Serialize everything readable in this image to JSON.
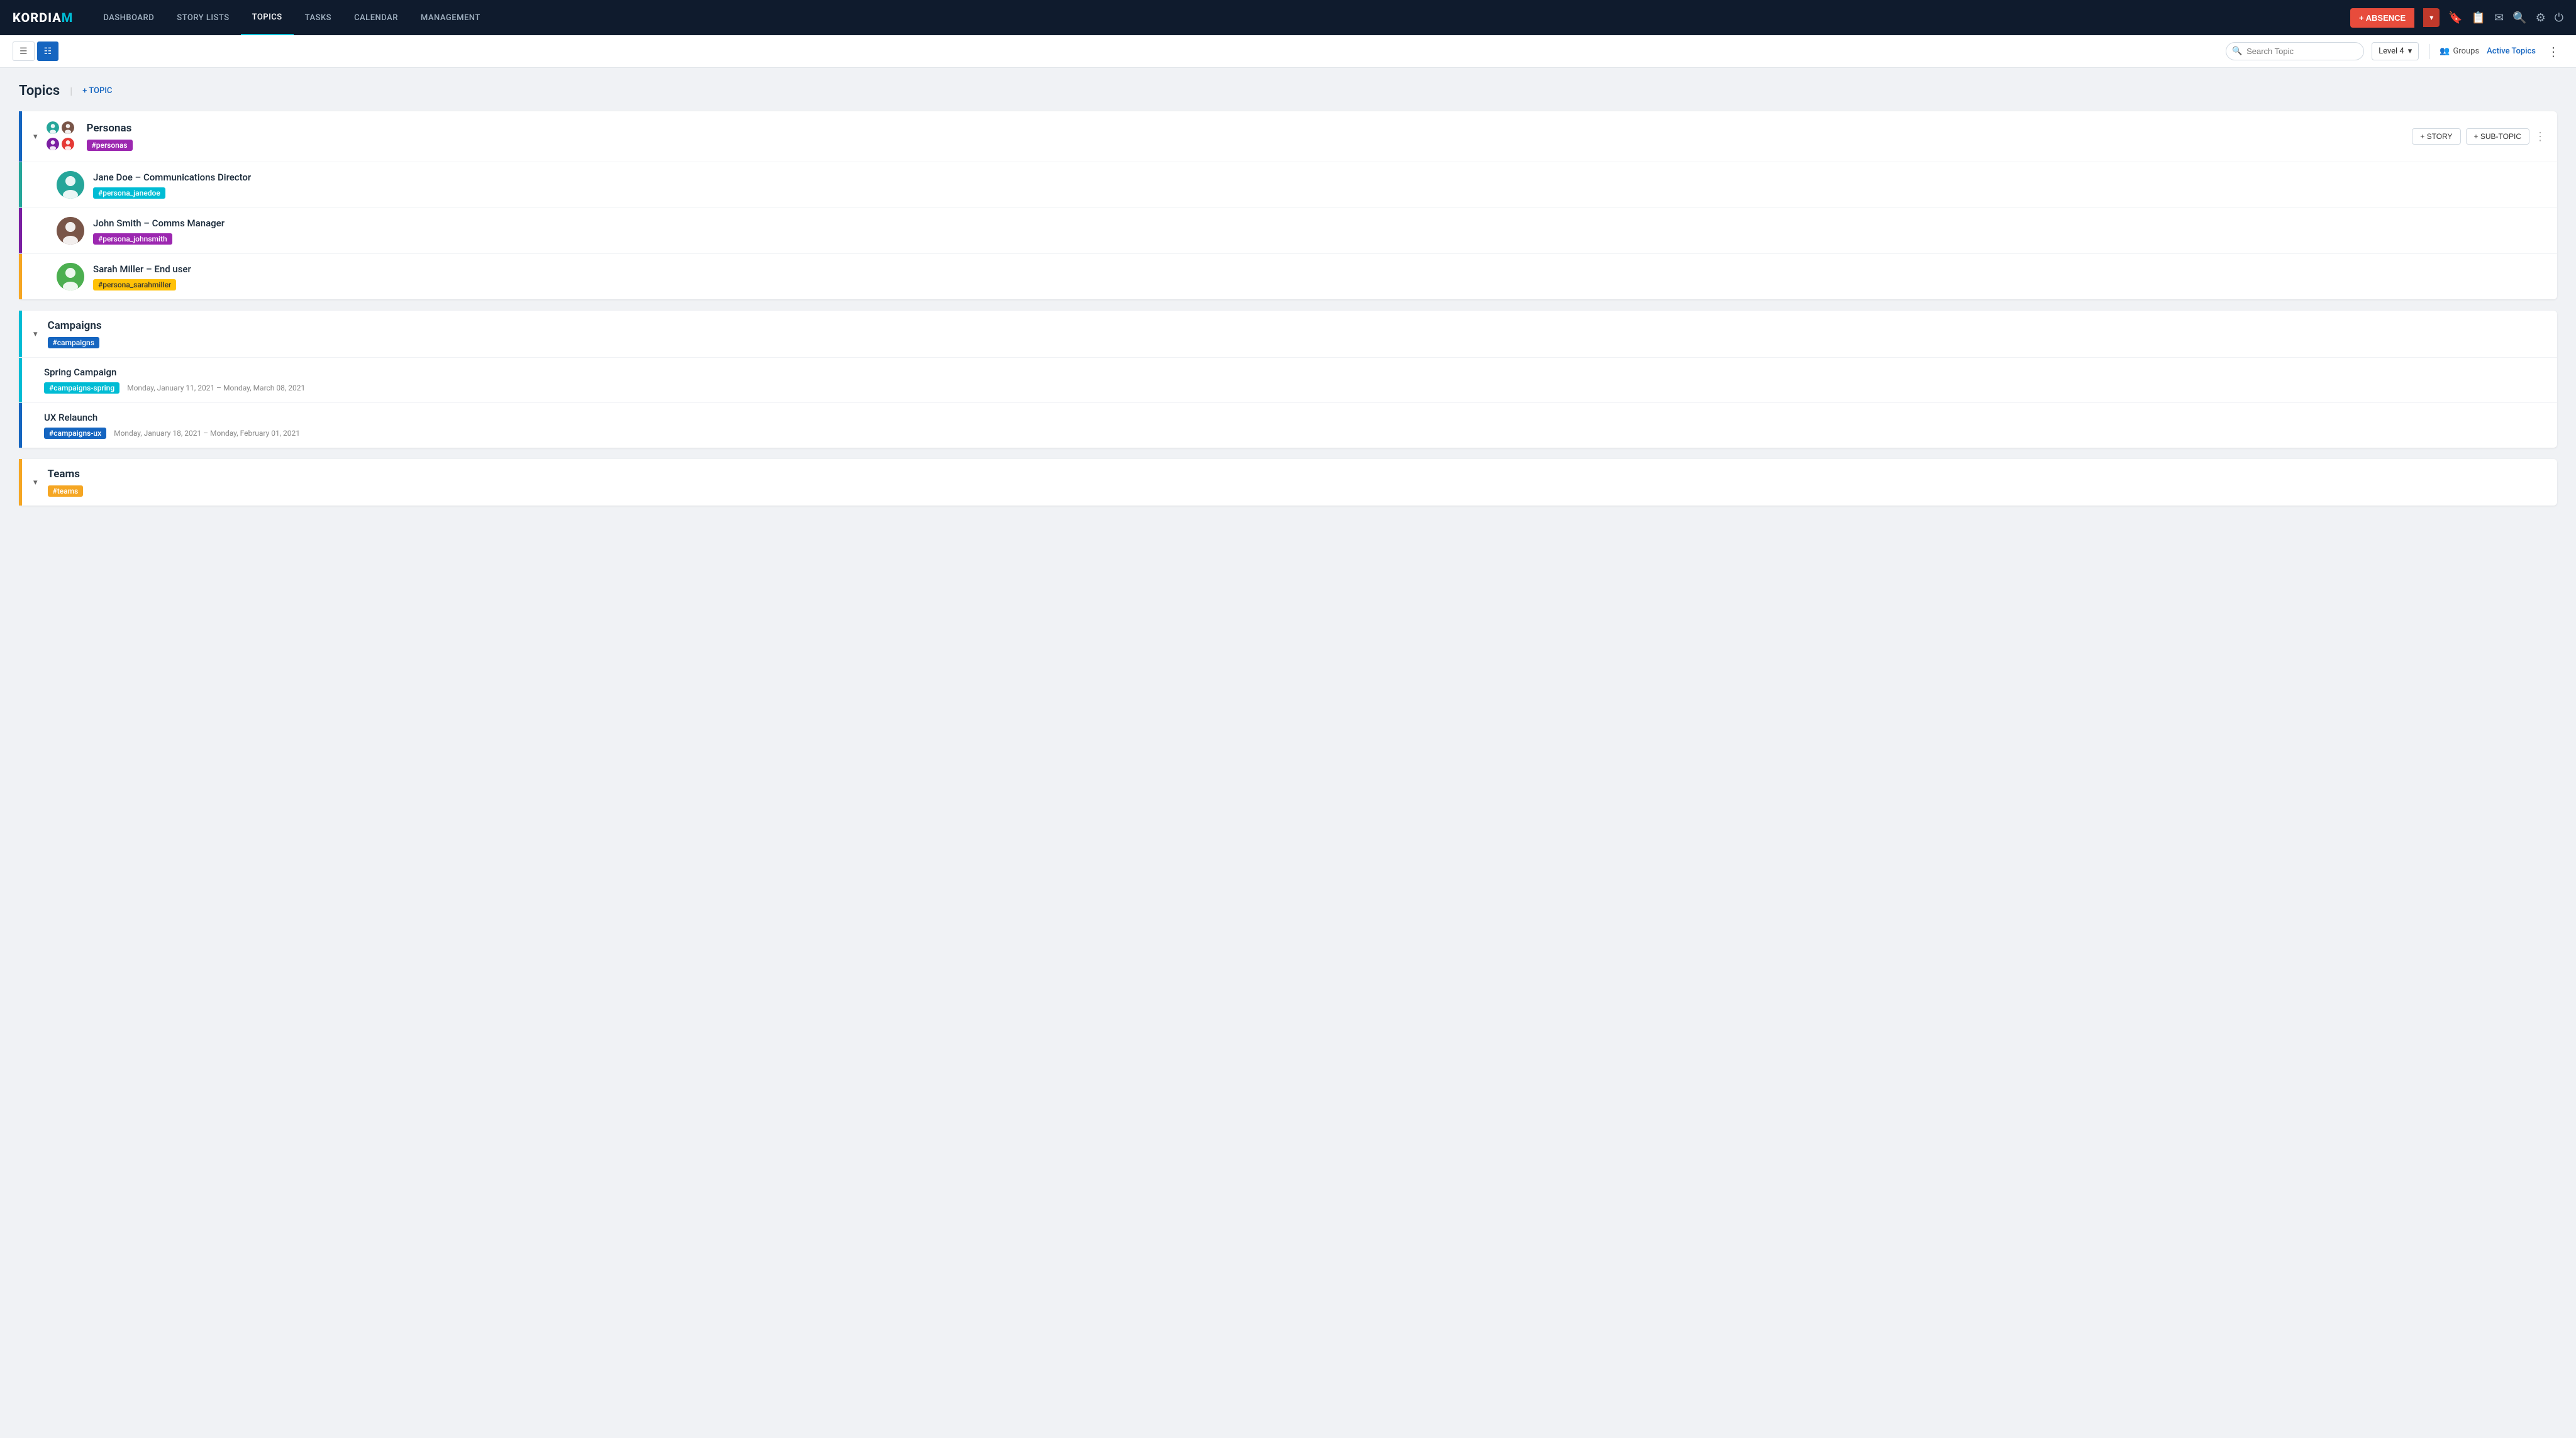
{
  "app": {
    "logo": "KORDIAM"
  },
  "nav": {
    "links": [
      {
        "label": "DASHBOARD",
        "active": false
      },
      {
        "label": "STORY LISTS",
        "active": false
      },
      {
        "label": "TOPICS",
        "active": true
      },
      {
        "label": "TASKS",
        "active": false
      },
      {
        "label": "CALENDAR",
        "active": false
      },
      {
        "label": "MANAGEMENT",
        "active": false
      }
    ],
    "absence_btn": "+ ABSENCE",
    "icons": [
      "bookmark",
      "clipboard",
      "mail",
      "search",
      "settings",
      "logout"
    ]
  },
  "toolbar": {
    "view_list_label": "☰",
    "view_detail_label": "☰",
    "search_placeholder": "Search Topic",
    "level_label": "Level 4",
    "groups_label": "Groups",
    "active_topics_label": "Active Topics"
  },
  "page": {
    "title": "Topics",
    "add_topic": "+ TOPIC"
  },
  "topics": [
    {
      "id": "personas",
      "name": "Personas",
      "tag": "#personas",
      "tag_color": "tag-purple",
      "border_color": "blue-border",
      "has_avatars": true,
      "actions": {
        "story": "+ STORY",
        "subtopic": "+ SUB-TOPIC"
      },
      "subtopics": [
        {
          "name": "Jane Doe – Communications Director",
          "tag": "#persona_janedoe",
          "tag_color": "tag-teal",
          "accent_color": "#26a69a",
          "avatar_type": "female1"
        },
        {
          "name": "John Smith – Comms Manager",
          "tag": "#persona_johnsmith",
          "tag_color": "tag-purple",
          "accent_color": "#7b1fa2",
          "avatar_type": "male1"
        },
        {
          "name": "Sarah Miller – End user",
          "tag": "#persona_sarahmiller",
          "tag_color": "tag-yellow",
          "accent_color": "#f5a623",
          "avatar_type": "female2"
        }
      ]
    },
    {
      "id": "campaigns",
      "name": "Campaigns",
      "tag": "#campaigns",
      "tag_color": "tag-blue",
      "border_color": "teal-border",
      "has_avatars": false,
      "subtopics": [
        {
          "name": "Spring Campaign",
          "tag": "#campaigns-spring",
          "tag_color": "tag-teal",
          "accent_color": "#00bcd4",
          "date": "Monday, January 11, 2021 – Monday, March 08, 2021"
        },
        {
          "name": "UX Relaunch",
          "tag": "#campaigns-ux",
          "tag_color": "tag-blue",
          "accent_color": "#1565c0",
          "date": "Monday, January 18, 2021 – Monday, February 01, 2021"
        }
      ]
    },
    {
      "id": "teams",
      "name": "Teams",
      "tag": "#teams",
      "tag_color": "tag-orange",
      "border_color": "orange-border",
      "has_avatars": false,
      "subtopics": []
    }
  ]
}
